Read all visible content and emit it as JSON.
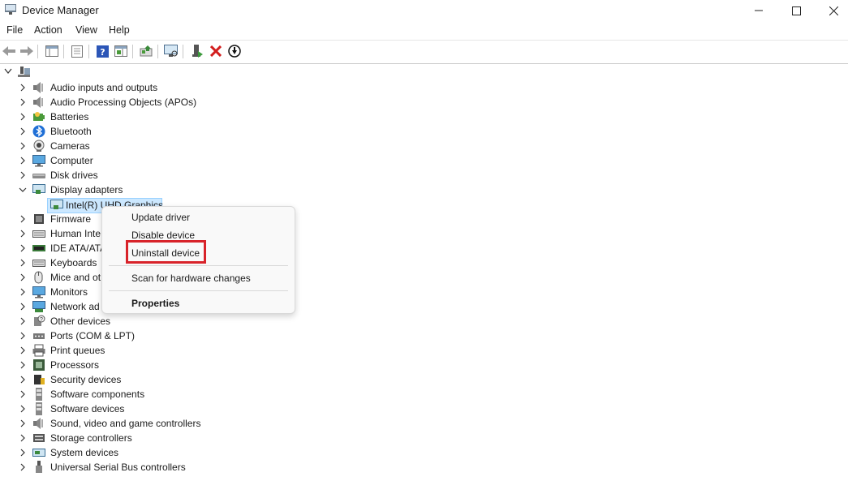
{
  "window": {
    "title": "Device Manager"
  },
  "menu": [
    "File",
    "Action",
    "View",
    "Help"
  ],
  "tree": {
    "categories": [
      {
        "label": "Audio inputs and outputs",
        "icon": "speaker-icon"
      },
      {
        "label": "Audio Processing Objects (APOs)",
        "icon": "speaker-icon"
      },
      {
        "label": "Batteries",
        "icon": "battery-icon"
      },
      {
        "label": "Bluetooth",
        "icon": "bluetooth-icon"
      },
      {
        "label": "Cameras",
        "icon": "camera-icon"
      },
      {
        "label": "Computer",
        "icon": "monitor-icon"
      },
      {
        "label": "Disk drives",
        "icon": "disk-icon"
      },
      {
        "label": "Display adapters",
        "icon": "display-adapter-icon",
        "expanded": true
      },
      {
        "label": "Firmware",
        "icon": "firmware-icon"
      },
      {
        "label": "Human Inte",
        "icon": "keyboard-icon"
      },
      {
        "label": "IDE ATA/ATA",
        "icon": "ide-icon"
      },
      {
        "label": "Keyboards",
        "icon": "keyboard-icon"
      },
      {
        "label": "Mice and ot",
        "icon": "mouse-icon"
      },
      {
        "label": "Monitors",
        "icon": "monitor-icon"
      },
      {
        "label": "Network ad",
        "icon": "network-icon"
      },
      {
        "label": "Other devices",
        "icon": "unknown-device-icon"
      },
      {
        "label": "Ports (COM & LPT)",
        "icon": "port-icon"
      },
      {
        "label": "Print queues",
        "icon": "printer-icon"
      },
      {
        "label": "Processors",
        "icon": "processor-icon"
      },
      {
        "label": "Security devices",
        "icon": "security-icon"
      },
      {
        "label": "Software components",
        "icon": "software-icon"
      },
      {
        "label": "Software devices",
        "icon": "software-icon"
      },
      {
        "label": "Sound, video and game controllers",
        "icon": "speaker-icon"
      },
      {
        "label": "Storage controllers",
        "icon": "storage-icon"
      },
      {
        "label": "System devices",
        "icon": "system-icon"
      },
      {
        "label": "Universal Serial Bus controllers",
        "icon": "usb-icon"
      }
    ],
    "selected_child": "Intel(R) UHD Graphics"
  },
  "context_menu": {
    "items": [
      "Update driver",
      "Disable device",
      "Uninstall device",
      "Scan for hardware changes",
      "Properties"
    ],
    "highlighted": "Uninstall device"
  },
  "colors": {
    "highlight_box": "#d8232a",
    "selection": "#cce8ff"
  }
}
